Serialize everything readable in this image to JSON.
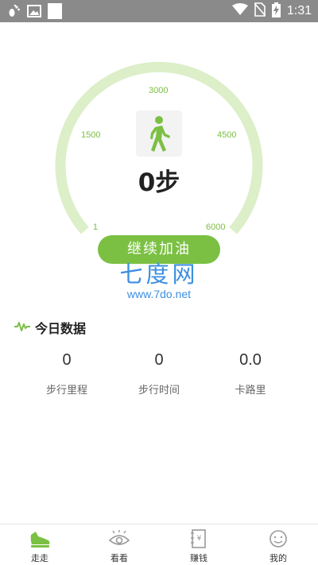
{
  "status_bar": {
    "time": "1:31"
  },
  "gauge": {
    "ticks": [
      "1",
      "1500",
      "3000",
      "4500",
      "6000"
    ],
    "current_steps": 0,
    "max_steps": 6000,
    "steps_text": "0步"
  },
  "continue_button": {
    "label": "继续加油"
  },
  "watermark": {
    "brand": "七度网",
    "url": "www.7do.net"
  },
  "today": {
    "title": "今日数据",
    "stats": [
      {
        "value": "0",
        "label": "步行里程"
      },
      {
        "value": "0",
        "label": "步行时间"
      },
      {
        "value": "0.0",
        "label": "卡路里"
      }
    ]
  },
  "nav": {
    "items": [
      {
        "label": "走走",
        "icon": "shoe-icon",
        "active": true
      },
      {
        "label": "看看",
        "icon": "eye-icon",
        "active": false
      },
      {
        "label": "赚钱",
        "icon": "money-book-icon",
        "active": false
      },
      {
        "label": "我的",
        "icon": "smiley-icon",
        "active": false
      }
    ]
  },
  "colors": {
    "accent": "#7bc043",
    "track": "#dcefc8",
    "status_bar": "#8a8a8a",
    "watermark": "#3d8fe0"
  }
}
